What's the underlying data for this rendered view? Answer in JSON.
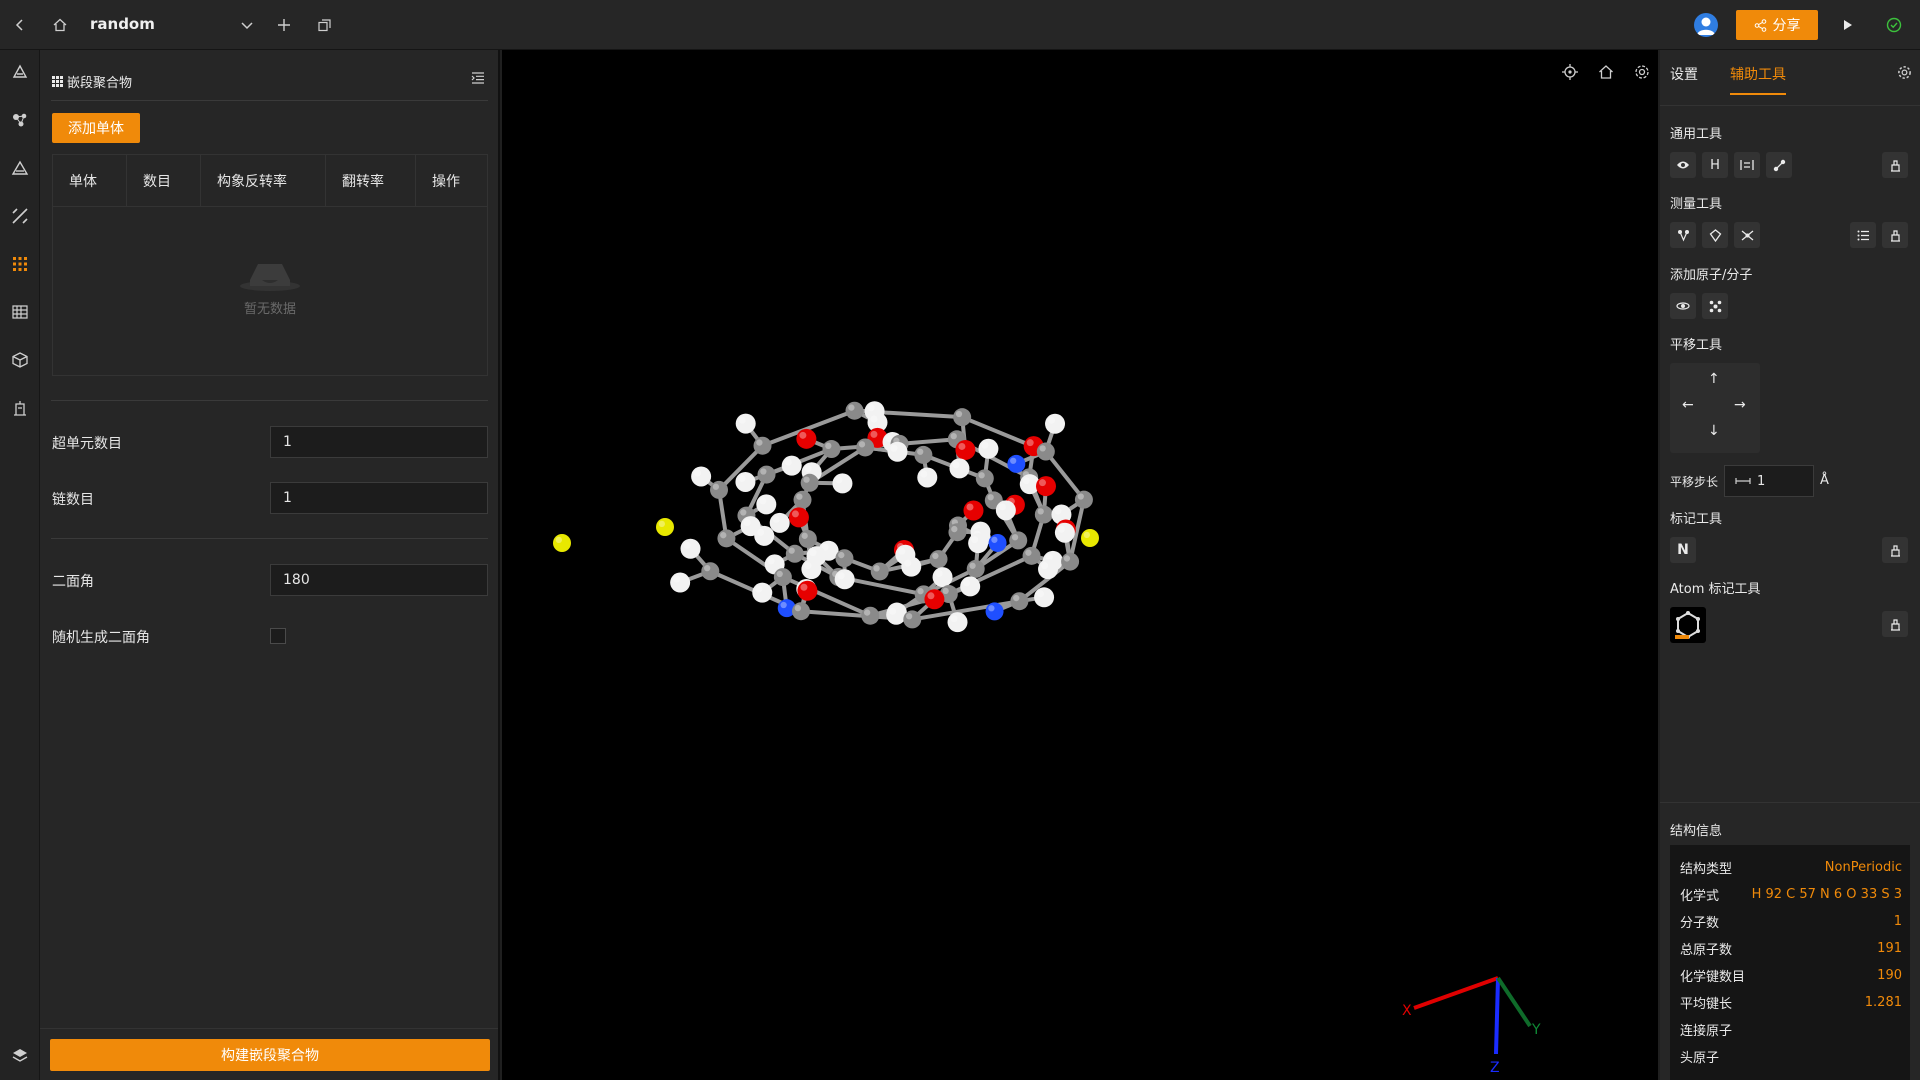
{
  "topbar": {
    "title": "random",
    "share_label": "分享"
  },
  "left_panel": {
    "header": "嵌段聚合物",
    "add_button": "添加单体",
    "table": {
      "columns": [
        "单体",
        "数目",
        "构象反转率",
        "翻转率",
        "操作"
      ],
      "empty_text": "暂无数据"
    },
    "fields": {
      "supercell_label": "超单元数目",
      "supercell_value": "1",
      "chains_label": "链数目",
      "chains_value": "1",
      "dihedral_label": "二面角",
      "dihedral_value": "180",
      "random_dihedral_label": "随机生成二面角"
    },
    "build_button": "构建嵌段聚合物"
  },
  "right_panel": {
    "tabs": {
      "settings": "设置",
      "aux_tools": "辅助工具"
    },
    "sections": {
      "general": "通用工具",
      "measure": "测量工具",
      "add_atom": "添加原子/分子",
      "translate": "平移工具",
      "step_label": "平移步长",
      "step_value": "1",
      "step_unit": "Å",
      "mark": "标记工具",
      "atom_mark": "Atom 标记工具",
      "h_button": "H",
      "n_button": "N"
    },
    "structure_info": {
      "title": "结构信息",
      "rows": [
        {
          "key": "结构类型",
          "value": "NonPeriodic"
        },
        {
          "key": "化学式",
          "value": "H 92 C 57 N 6 O 33 S 3"
        },
        {
          "key": "分子数",
          "value": "1"
        },
        {
          "key": "总原子数",
          "value": "191"
        },
        {
          "key": "化学键数目",
          "value": "190"
        },
        {
          "key": "平均键长",
          "value": "1.281"
        },
        {
          "key": "连接原子",
          "value": ""
        },
        {
          "key": "头原子",
          "value": ""
        }
      ]
    }
  },
  "axes": {
    "x": "X",
    "y": "Y",
    "z": "Z"
  },
  "colors": {
    "accent": "#f08a0a",
    "carbon": "#8a8a8a",
    "hydrogen": "#f2f2f2",
    "oxygen": "#e60000",
    "nitrogen": "#1f4fff",
    "sulfur": "#e8e800"
  }
}
